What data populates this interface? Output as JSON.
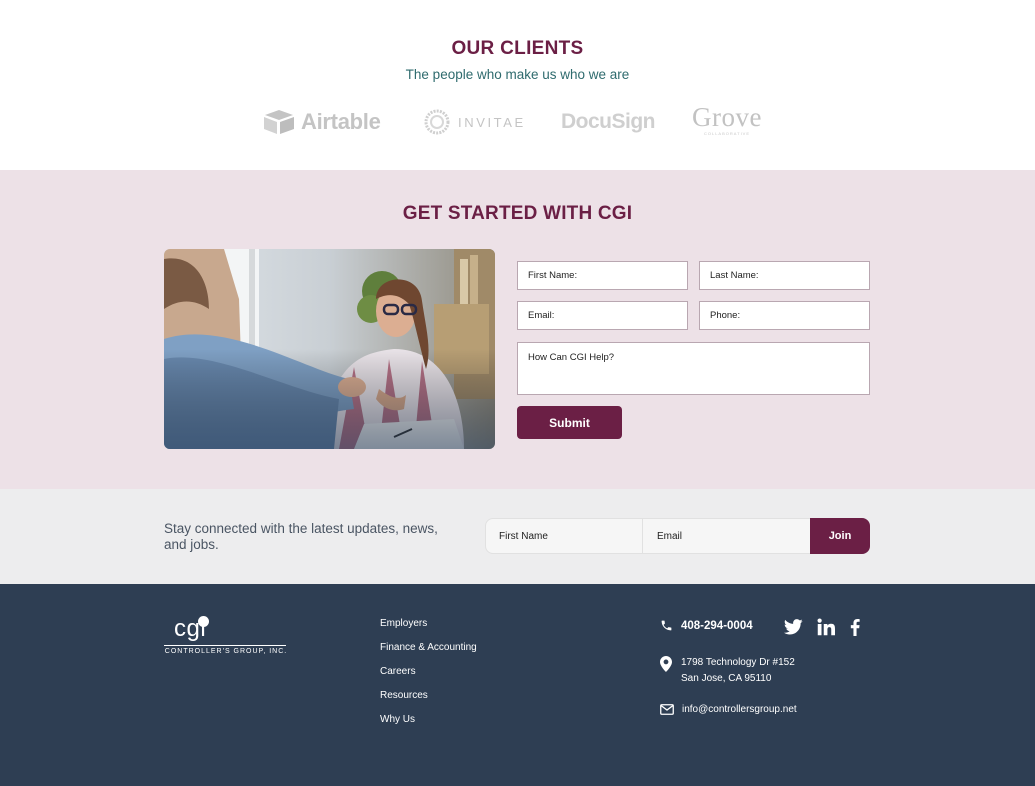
{
  "clients": {
    "title": "OUR CLIENTS",
    "subtitle": "The people who make us who we are",
    "logos": [
      {
        "name": "Airtable",
        "icon": "airtable-box-icon"
      },
      {
        "name": "INVITAE",
        "icon": "invitae-ring-icon"
      },
      {
        "name": "DocuSign",
        "icon": ""
      },
      {
        "name": "Grove",
        "tagline": "COLLABORATIVE",
        "icon": ""
      }
    ]
  },
  "get_started": {
    "title": "GET STARTED WITH CGI",
    "form": {
      "first_name_placeholder": "First Name:",
      "last_name_placeholder": "Last Name:",
      "email_placeholder": "Email:",
      "phone_placeholder": "Phone:",
      "help_placeholder": "How Can CGI Help?",
      "submit_label": "Submit"
    }
  },
  "newsletter": {
    "text": "Stay connected with the latest updates, news, and jobs.",
    "first_name_placeholder": "First Name",
    "email_placeholder": "Email",
    "join_label": "Join"
  },
  "footer": {
    "logo": {
      "word": "cgi",
      "tagline": "CONTROLLER'S GROUP, INC."
    },
    "links": [
      "Employers",
      "Finance & Accounting",
      "Careers",
      "Resources",
      "Why Us"
    ],
    "phone": "408-294-0004",
    "social": [
      {
        "name": "twitter-icon"
      },
      {
        "name": "linkedin-icon"
      },
      {
        "name": "facebook-icon"
      }
    ],
    "address_line1": "1798 Technology Dr #152",
    "address_line2": "San Jose, CA 95110",
    "email": "info@controllersgroup.net"
  },
  "colors": {
    "brand": "#6b1f45",
    "accent_teal": "#2f6b6e",
    "section_pink": "#ede1e7",
    "section_gray": "#ededee",
    "footer_navy": "#2e3e53"
  }
}
